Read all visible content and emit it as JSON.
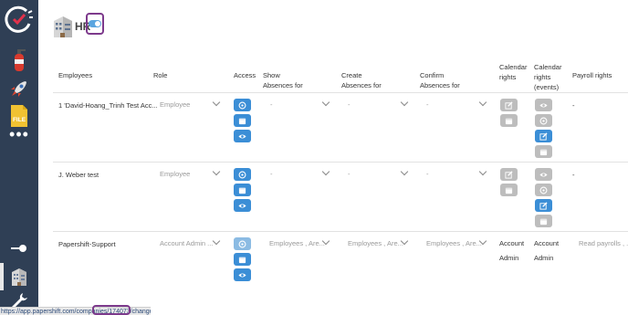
{
  "sidebar": {
    "items": [
      {
        "icon": "shiftplanning-logo-icon"
      },
      {
        "icon": "extinguisher-icon"
      },
      {
        "icon": "rocket-icon"
      },
      {
        "icon": "file-icon",
        "label": "FILE"
      },
      {
        "icon": "more-dots-icon",
        "label": "•••"
      },
      {
        "icon": "toggle-icon"
      },
      {
        "icon": "building-icon"
      },
      {
        "icon": "wrench-icon"
      }
    ]
  },
  "header": {
    "title": "HR"
  },
  "table": {
    "headers": {
      "employees": "Employees",
      "role": "Role",
      "access": "Access",
      "show_absences": "Show\nAbsences for",
      "create_absences": "Create\nAbsences for",
      "confirm_absences": "Confirm\nAbsences for",
      "calendar_rights": "Calendar\nrights",
      "calendar_rights_events": "Calendar\nrights\n(events)",
      "payroll_rights": "Payroll rights"
    },
    "rows": [
      {
        "name": "1 'David-Hoang_Trinh Test Acc...",
        "role": "Employee",
        "show": "-",
        "create": "-",
        "confirm": "-",
        "payroll": "-"
      },
      {
        "name": "J. Weber test",
        "role": "Employee",
        "show": "-",
        "create": "-",
        "confirm": "-",
        "payroll": "-"
      },
      {
        "name": "Papershift-Support",
        "role": "Account Admin ...",
        "show": "Employees , Are...",
        "create": "Employees , Are...",
        "confirm": "Employees , Are...",
        "calendar_rights_text": "Account\n\nAdmin",
        "calendar_events_text": "Account\n\nAdmin",
        "payroll": "Read payrolls , ..."
      }
    ]
  },
  "statusbar": {
    "url": "https://app.papershift.com/companies/174073/change"
  },
  "colors": {
    "sidebar": "#2f3f55",
    "button_blue": "#3b8ed6",
    "button_grey": "#bdbdbd",
    "highlight": "#7d3a8c"
  }
}
